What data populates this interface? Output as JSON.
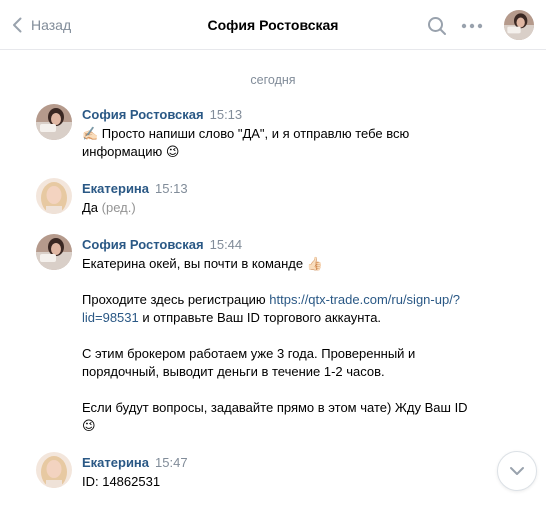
{
  "header": {
    "back_label": "Назад",
    "title": "София Ростовская"
  },
  "date_separator": "сегодня",
  "messages": [
    {
      "author": "София Ростовская",
      "time": "15:13",
      "paragraphs": [
        "✍🏻 Просто напиши слово \"ДА\", и я отправлю тебе всю информацию 😉"
      ]
    },
    {
      "author": "Екатерина",
      "time": "15:13",
      "text": "Да",
      "edited": "(ред.)"
    },
    {
      "author": "София Ростовская",
      "time": "15:44",
      "p1": "Екатерина окей, вы почти в команде 👍🏻",
      "p2_before": "Проходите здесь регистрацию ",
      "p2_link": "https://qtx-trade.com/ru/sign-up/?lid=98531",
      "p2_after": " и отправьте Ваш ID торгового аккаунта.",
      "p3": "С этим брокером работаем уже 3 года. Проверенный и порядочный, выводит деньги в течение 1-2 часов.",
      "p4": "Если будут вопросы, задавайте прямо в этом чате) Жду Ваш ID 😉"
    },
    {
      "author": "Екатерина",
      "time": "15:47",
      "text": "ID: 14862531"
    }
  ],
  "icons": {
    "back": "chevron-left-icon",
    "search": "search-icon",
    "more": "more-horizontal-icon",
    "scroll_down": "chevron-down-icon"
  },
  "colors": {
    "link": "#2a5885",
    "secondary": "#818c99"
  }
}
